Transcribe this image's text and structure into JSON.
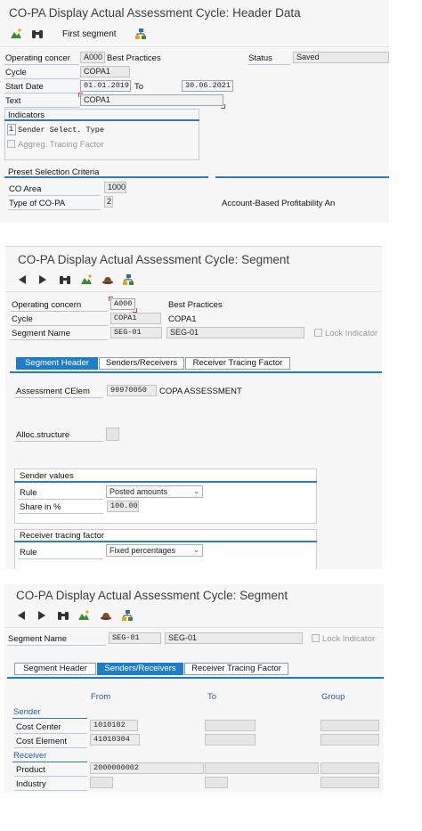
{
  "s1": {
    "title": "CO-PA Display Actual Assessment Cycle: Header Data",
    "toolbar": {
      "first_segment": "First segment"
    },
    "operating_concern_label": "Operating concer",
    "operating_concern_value": "A000",
    "operating_concern_desc": "Best Practices",
    "status_label": "Status",
    "status_value": "Saved",
    "cycle_label": "Cycle",
    "cycle_value": "COPA1",
    "start_date_label": "Start Date",
    "start_date_value": "01.01.2019",
    "to_label": "To",
    "to_value": "30.06.2021",
    "text_label": "Text",
    "text_value": "COPA1",
    "indicators_title": "Indicators",
    "sender_select_num": "1",
    "sender_select_label": "Sender Select. Type",
    "aggreg_label": "Aggreg. Tracing Factor",
    "preset_title": "Preset Selection Criteria",
    "co_area_label": "CO Area",
    "co_area_value": "1000",
    "type_copa_label": "Type of CO-PA",
    "type_copa_value": "2",
    "type_copa_desc": "Account-Based Profitability An"
  },
  "s2": {
    "title": "CO-PA Display Actual Assessment Cycle: Segment",
    "operating_concern_label": "Operating concern",
    "operating_concern_value": "A000",
    "operating_concern_desc": "Best Practices",
    "cycle_label": "Cycle",
    "cycle_value": "COPA1",
    "cycle_desc": "COPA1",
    "segment_name_label": "Segment Name",
    "segment_name_value": "SEG-01",
    "segment_name_desc": "SEG-01",
    "lock_label": "Lock Indicator",
    "tabs": [
      "Segment Header",
      "Senders/Receivers",
      "Receiver Tracing Factor"
    ],
    "assessment_label": "Assessment CElem",
    "assessment_value": "99970050",
    "assessment_desc": "COPA ASSESSMENT",
    "alloc_label": "Alloc.structure",
    "sender_values_title": "Sender values",
    "rule_label": "Rule",
    "rule_value": "Posted amounts",
    "share_label": "Share in %",
    "share_value": "100.00",
    "receiver_factor_title": "Receiver tracing factor",
    "rule2_label": "Rule",
    "rule2_value": "Fixed percentages"
  },
  "s3": {
    "title": "CO-PA Display Actual Assessment Cycle: Segment",
    "segment_name_label": "Segment Name",
    "segment_name_value": "SEG-01",
    "segment_name_desc": "SEG-01",
    "lock_label": "Lock Indicator",
    "tabs": [
      "Segment Header",
      "Senders/Receivers",
      "Receiver Tracing Factor"
    ],
    "col_from": "From",
    "col_to": "To",
    "col_group": "Group",
    "sender_section": "Sender",
    "cost_center_label": "Cost Center",
    "cost_center_from": "1010102",
    "cost_element_label": "Cost Element",
    "cost_element_from": "41010304",
    "receiver_section": "Receiver",
    "product_label": "Product",
    "product_from": "2000000002",
    "industry_label": "Industry"
  },
  "colors": {
    "sap_blue": "#1f7dc8",
    "section_blue": "#2a5a9c",
    "required_red": "#d23a2a"
  },
  "icons": [
    "mountain-icon",
    "binoculars-icon",
    "structure-icon",
    "back-arrow-icon",
    "forward-arrow-icon",
    "hat-icon"
  ]
}
